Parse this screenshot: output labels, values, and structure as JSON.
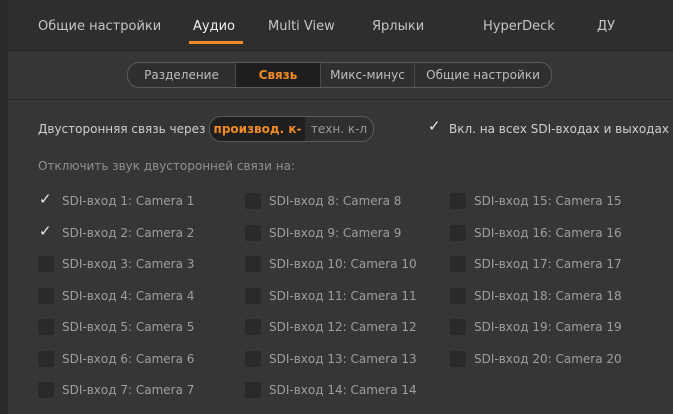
{
  "tabs": [
    "Общие настройки",
    "Аудио",
    "Multi View",
    "Ярлыки",
    "HyperDeck",
    "ДУ"
  ],
  "subtabs": [
    "Разделение",
    "Связь",
    "Микс-минус",
    "Общие настройки"
  ],
  "talkback": {
    "label": "Двусторонняя связь через",
    "options": [
      "производ. к-л",
      "техн. к-л"
    ],
    "selected": "производ. к-л",
    "all_label": "Вкл. на всех SDI-входах и выходах",
    "all_checked": true
  },
  "mute_heading": "Отключить звук двусторонней связи на:",
  "inputs": [
    {
      "label": "SDI-вход 1: Camera 1",
      "checked": true
    },
    {
      "label": "SDI-вход 2: Camera 2",
      "checked": true
    },
    {
      "label": "SDI-вход 3: Camera 3",
      "checked": false
    },
    {
      "label": "SDI-вход 4: Camera 4",
      "checked": false
    },
    {
      "label": "SDI-вход 5: Camera 5",
      "checked": false
    },
    {
      "label": "SDI-вход 6: Camera 6",
      "checked": false
    },
    {
      "label": "SDI-вход 7: Camera 7",
      "checked": false
    },
    {
      "label": "SDI-вход 8: Camera 8",
      "checked": false
    },
    {
      "label": "SDI-вход 9: Camera 9",
      "checked": false
    },
    {
      "label": "SDI-вход 10: Camera 10",
      "checked": false
    },
    {
      "label": "SDI-вход 11: Camera 11",
      "checked": false
    },
    {
      "label": "SDI-вход 12: Camera 12",
      "checked": false
    },
    {
      "label": "SDI-вход 13: Camera 13",
      "checked": false
    },
    {
      "label": "SDI-вход 14: Camera 14",
      "checked": false
    },
    {
      "label": "SDI-вход 15: Camera 15",
      "checked": false
    },
    {
      "label": "SDI-вход 16: Camera 16",
      "checked": false
    },
    {
      "label": "SDI-вход 17: Camera 17",
      "checked": false
    },
    {
      "label": "SDI-вход 18: Camera 18",
      "checked": false
    },
    {
      "label": "SDI-вход 19: Camera 19",
      "checked": false
    },
    {
      "label": "SDI-вход 20: Camera 20",
      "checked": false
    }
  ],
  "colors": {
    "accent": "#f08a24",
    "panel": "#363636",
    "text": "#a9a9a9"
  }
}
